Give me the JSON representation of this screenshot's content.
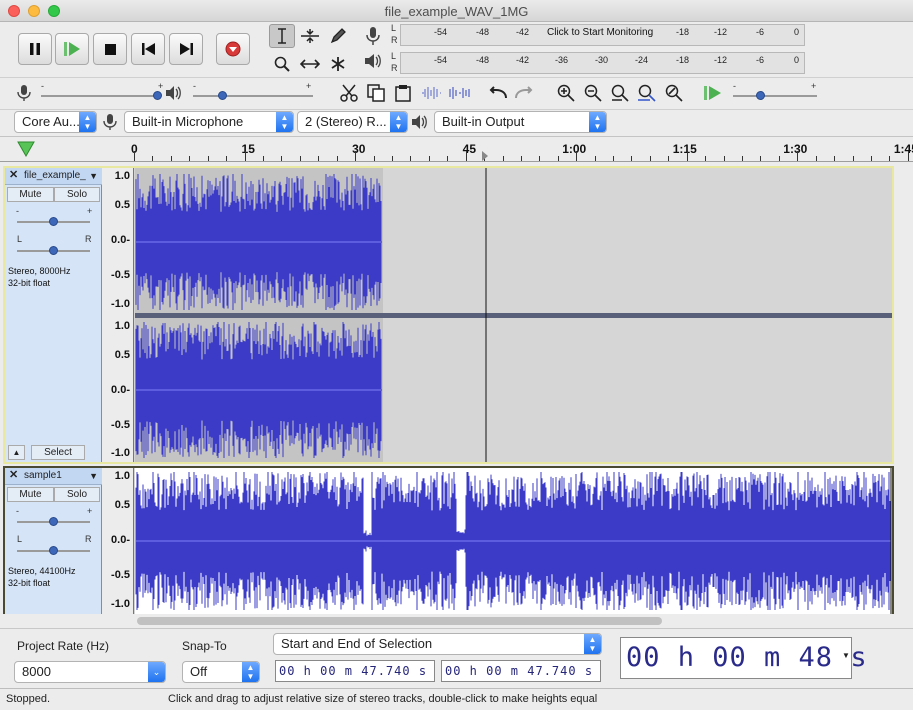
{
  "window": {
    "title": "file_example_WAV_1MG"
  },
  "meters": {
    "record_channels": [
      "L",
      "R"
    ],
    "record_ticks": [
      "-54",
      "-48",
      "-42",
      "-18",
      "-12",
      "-6",
      "0"
    ],
    "monitor_label": "Click to Start Monitoring",
    "play_channels": [
      "L",
      "R"
    ],
    "play_ticks": [
      "-54",
      "-48",
      "-42",
      "-36",
      "-30",
      "-24",
      "-18",
      "-12",
      "-6",
      "0"
    ]
  },
  "sliders": {
    "minus": "-",
    "plus": "+",
    "record_volume": 1.0,
    "playback_volume": 0.25
  },
  "device": {
    "host": "Core Au...",
    "input": "Built-in Microphone",
    "channels": "2 (Stereo) R...",
    "output": "Built-in Output"
  },
  "timeline": {
    "ticks": [
      "0",
      "15",
      "30",
      "45",
      "1:00",
      "1:15",
      "1:30",
      "1:45"
    ]
  },
  "tracks": [
    {
      "name": "file_example_",
      "mute": "Mute",
      "solo": "Solo",
      "gain_minus": "-",
      "gain_plus": "+",
      "pan_left": "L",
      "pan_right": "R",
      "info_line1": "Stereo, 8000Hz",
      "info_line2": "32-bit float",
      "select": "Select",
      "ruler": [
        "1.0",
        "0.5",
        "0.0-",
        "-0.5",
        "-1.0"
      ]
    },
    {
      "name": "sample1",
      "mute": "Mute",
      "solo": "Solo",
      "gain_minus": "-",
      "gain_plus": "+",
      "pan_left": "L",
      "pan_right": "R",
      "info_line1": "Stereo, 44100Hz",
      "info_line2": "32-bit float",
      "ruler": [
        "1.0",
        "0.5",
        "0.0-",
        "-0.5",
        "-1.0"
      ]
    }
  ],
  "selection_toolbar": {
    "project_rate_label": "Project Rate (Hz)",
    "project_rate": "8000",
    "snap_to_label": "Snap-To",
    "snap_to": "Off",
    "selection_mode": "Start and End of Selection",
    "start_time": "00 h 00 m 47.740 s",
    "end_time": "00 h 00 m 47.740 s",
    "audio_position": "00 h 00 m 48 s"
  },
  "status": {
    "state": "Stopped.",
    "hint": "Click and drag to adjust relative size of stereo tracks, double-click to make heights equal"
  },
  "colors": {
    "waveform": "#3b3bc8",
    "track_background": "#d4d4d4",
    "track_panel": "#d5e4f7"
  }
}
